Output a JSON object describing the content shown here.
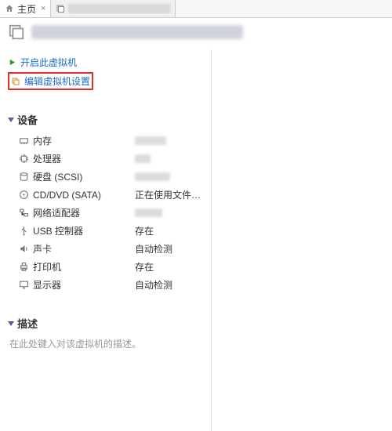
{
  "tabs": {
    "home_label": "主页"
  },
  "actions": {
    "power_on": "开启此虚拟机",
    "edit_settings": "编辑虚拟机设置"
  },
  "sections": {
    "devices_label": "设备",
    "description_label": "描述"
  },
  "devices": {
    "memory": {
      "label": "内存",
      "value": ""
    },
    "cpu": {
      "label": "处理器",
      "value": ""
    },
    "disk": {
      "label": "硬盘 (SCSI)",
      "value": ""
    },
    "cd": {
      "label": "CD/DVD (SATA)",
      "value": "正在使用文件 D:..."
    },
    "net": {
      "label": "网络适配器",
      "value": ""
    },
    "usb": {
      "label": "USB 控制器",
      "value": "存在"
    },
    "sound": {
      "label": "声卡",
      "value": "自动检测"
    },
    "printer": {
      "label": "打印机",
      "value": "存在"
    },
    "display": {
      "label": "显示器",
      "value": "自动检测"
    }
  },
  "description": {
    "placeholder": "在此处键入对该虚拟机的描述。"
  }
}
